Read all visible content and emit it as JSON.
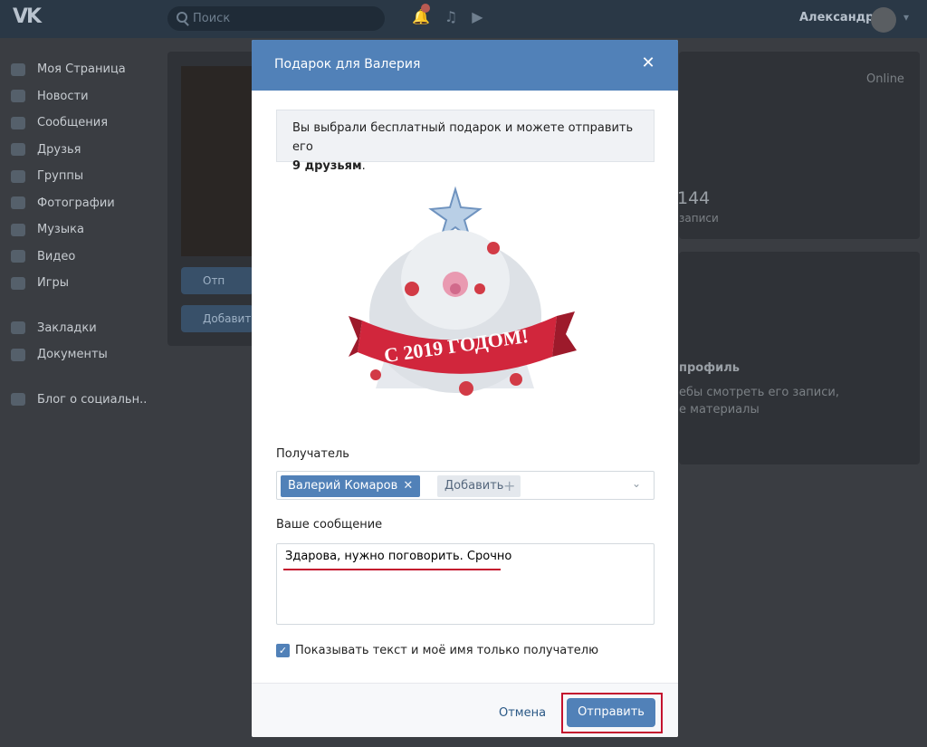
{
  "header": {
    "logo": "VK",
    "search_placeholder": "Поиск",
    "user_name": "Александр"
  },
  "sidebar": {
    "items": [
      {
        "label": "Моя Страница"
      },
      {
        "label": "Новости"
      },
      {
        "label": "Сообщения"
      },
      {
        "label": "Друзья"
      },
      {
        "label": "Группы"
      },
      {
        "label": "Фотографии"
      },
      {
        "label": "Музыка"
      },
      {
        "label": "Видео"
      },
      {
        "label": "Игры"
      },
      {
        "label": "Закладки"
      },
      {
        "label": "Документы"
      },
      {
        "label": "Блог о социальн.."
      }
    ]
  },
  "background": {
    "status": "Online",
    "count": "144",
    "count_label": "записи",
    "btn1": "Отп",
    "btn2": "Добавит",
    "section_title": "профиль",
    "line1": "ебы смотреть его записи,",
    "line2": "е материалы"
  },
  "modal": {
    "title": "Подарок для Валерия",
    "notice_text": "Вы выбрали бесплатный подарок и можете отправить его",
    "notice_bold": "9 друзьям",
    "gift_banner": "С 2019 ГОДОМ!",
    "recipient_label": "Получатель",
    "recipient_chip": "Валерий Комаров",
    "add_label": "Добавить",
    "message_label": "Ваше сообщение",
    "message_value": "Здарова, нужно поговорить. Срочно",
    "checkbox_label": "Показывать текст и моё имя только получателю",
    "cancel_label": "Отмена",
    "send_label": "Отправить"
  },
  "colors": {
    "header": "#2a3846",
    "modal_header": "#5181b8",
    "accent": "#5181b8",
    "highlight": "#c4122e"
  }
}
